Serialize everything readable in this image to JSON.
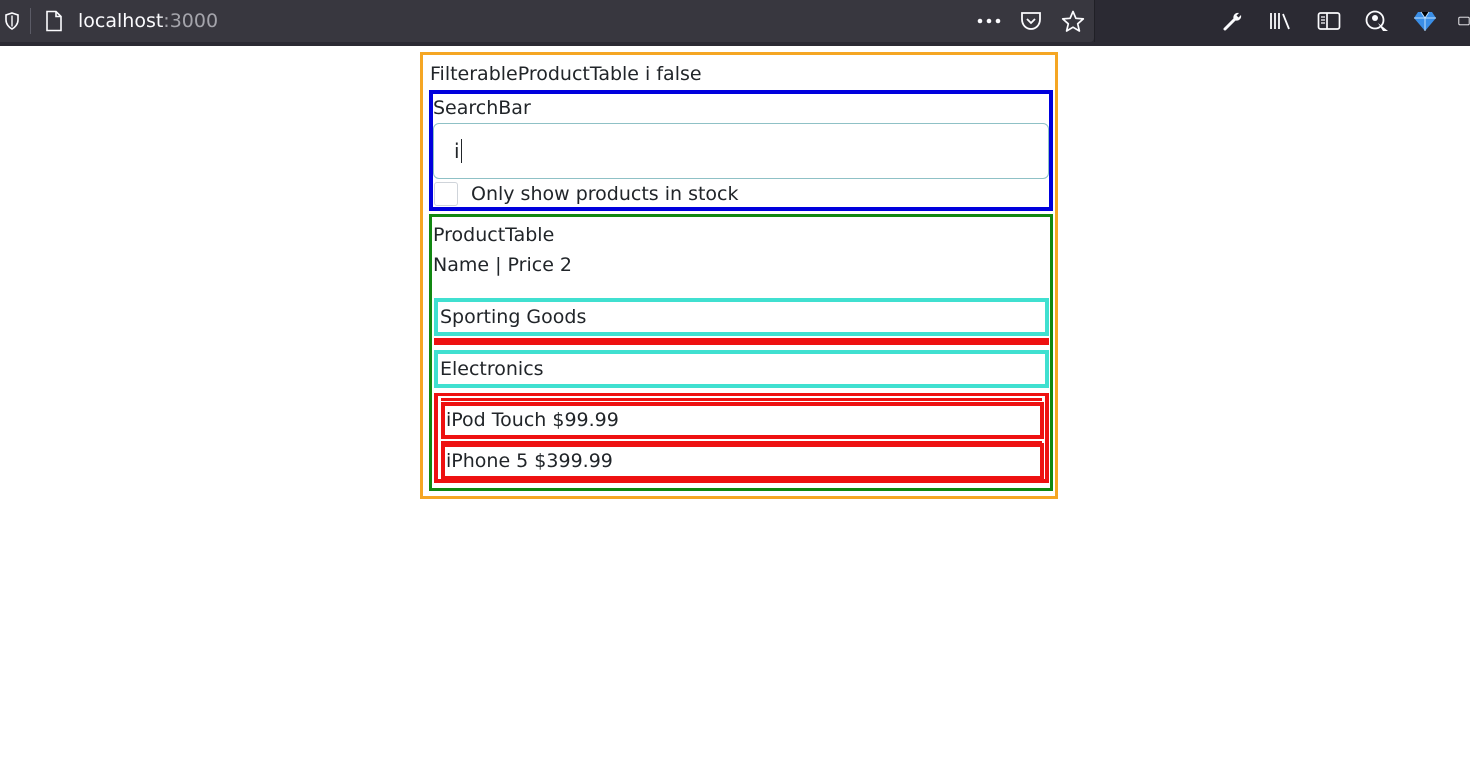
{
  "browser": {
    "url_host": "localhost",
    "url_port": ":3000"
  },
  "app": {
    "title": "FilterableProductTable i false",
    "searchbar": {
      "label": "SearchBar",
      "input_value": "i",
      "checkbox_label": "Only show products in stock",
      "checkbox_checked": false
    },
    "product_table": {
      "label": "ProductTable",
      "header": "Name | Price 2",
      "categories": [
        {
          "name": "Sporting Goods",
          "products": []
        },
        {
          "name": "Electronics",
          "products": [
            {
              "text": "iPod Touch $99.99"
            },
            {
              "text": "iPhone 5 $399.99"
            }
          ]
        }
      ]
    }
  },
  "colors": {
    "app_border": "#f5a623",
    "searchbar_border": "#0000dd",
    "product_table_border": "#118811",
    "category_border": "#40e0d0",
    "product_border": "#ee1111"
  }
}
